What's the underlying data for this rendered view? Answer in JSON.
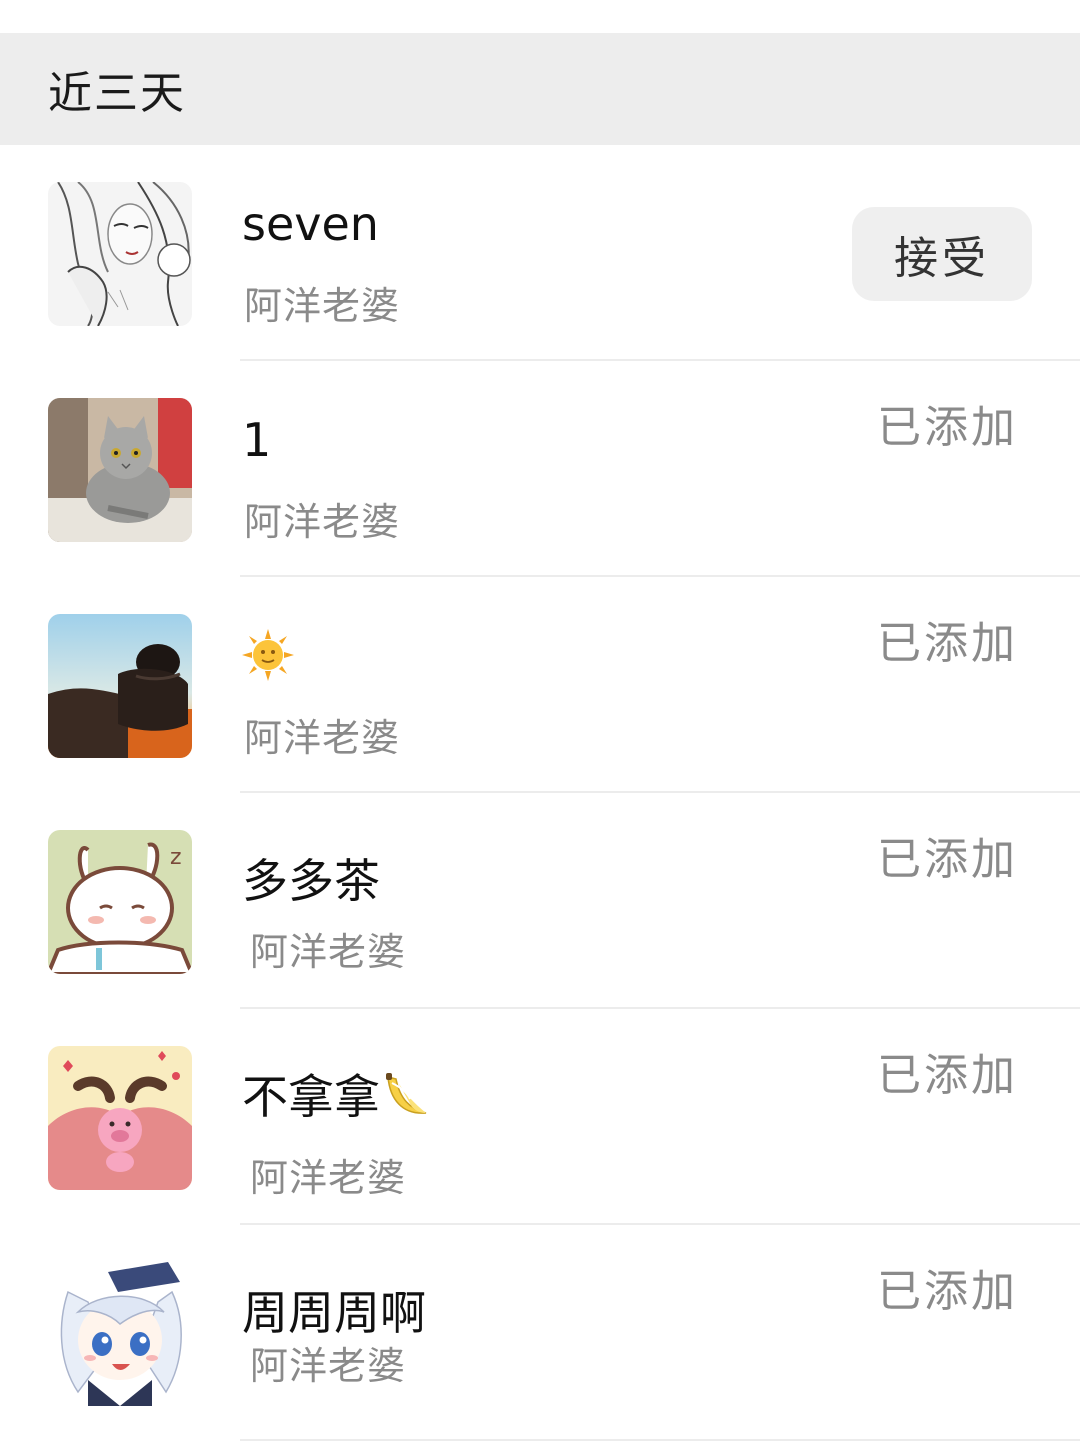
{
  "section": {
    "title": "近三天"
  },
  "requests": [
    {
      "nickname": "seven",
      "remark": "阿洋老婆",
      "action": "接受",
      "avatar": "manga-girl-avatar"
    },
    {
      "nickname": "1",
      "remark": "阿洋老婆",
      "status": "已添加",
      "avatar": "cat-avatar"
    },
    {
      "nickname": "",
      "nickname_emoji": "sun-face-emoji",
      "remark": "阿洋老婆",
      "status": "已添加",
      "avatar": "sunset-person-avatar"
    },
    {
      "nickname": "多多茶",
      "remark": "阿洋老婆",
      "status": "已添加",
      "avatar": "sleepy-bunny-avatar"
    },
    {
      "nickname": "不拿拿",
      "nickname_emoji": "banana-emoji",
      "remark": "阿洋老婆",
      "status": "已添加",
      "avatar": "pink-pig-avatar"
    },
    {
      "nickname": "周周周啊",
      "remark": "阿洋老婆",
      "status": "已添加",
      "avatar": "anime-girl-avatar"
    }
  ],
  "colors": {
    "header_bg": "#ededed",
    "button_bg": "#efefef",
    "secondary_text": "#8a8a8a",
    "divider": "#ececec"
  }
}
